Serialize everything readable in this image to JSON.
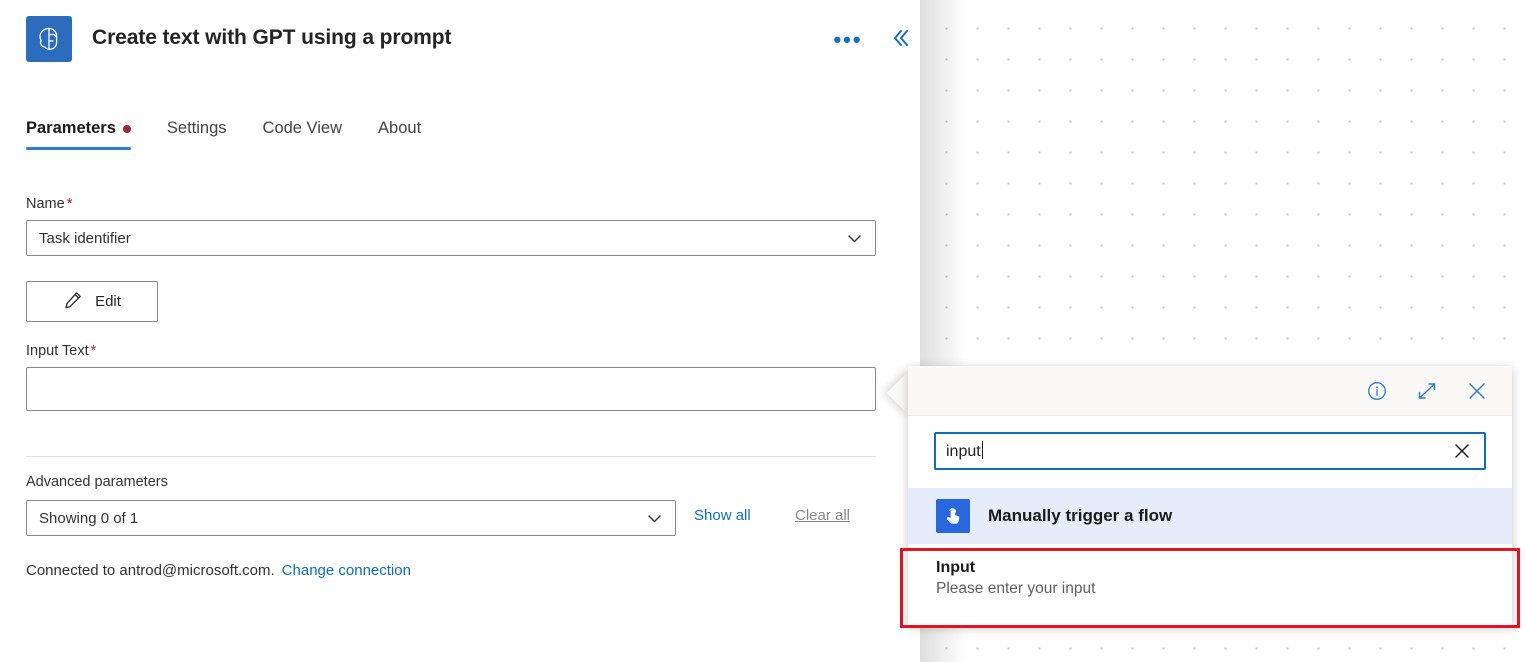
{
  "header": {
    "title": "Create text with GPT using a prompt",
    "app_icon": "gpt-brain-icon",
    "more_label": "•••",
    "more_name": "more-options-icon",
    "collapse_name": "collapse-panel-icon"
  },
  "tabs": [
    {
      "label": "Parameters",
      "active": true,
      "has_dot": true
    },
    {
      "label": "Settings",
      "active": false,
      "has_dot": false
    },
    {
      "label": "Code View",
      "active": false,
      "has_dot": false
    },
    {
      "label": "About",
      "active": false,
      "has_dot": false
    }
  ],
  "form": {
    "name": {
      "label": "Name",
      "required": "*",
      "value": "Task identifier"
    },
    "edit_button": {
      "label": "Edit",
      "icon": "pencil-icon"
    },
    "input_text": {
      "label": "Input Text",
      "required": "*",
      "value": "",
      "placeholder": ""
    },
    "advanced": {
      "label": "Advanced parameters",
      "value": "Showing 0 of 1",
      "show_all": "Show all",
      "clear_all": "Clear all"
    },
    "connection": {
      "text": "Connected to antrod@microsoft.com.",
      "change_link": "Change connection"
    }
  },
  "flyout": {
    "icons": {
      "info": "info-icon",
      "expand": "expand-icon",
      "close": "close-icon"
    },
    "search": {
      "value": "input",
      "placeholder": "Search dynamic content",
      "clear_name": "clear-search-icon"
    },
    "group": {
      "label": "Manually trigger a flow",
      "icon": "manual-trigger-icon"
    },
    "result": {
      "title": "Input",
      "subtitle": "Please enter your input"
    }
  },
  "colors": {
    "accent_blue": "#0f6cbd",
    "icon_blue": "#2b7cd3",
    "required_red": "#a4262c",
    "highlight_red": "#e81123",
    "group_bg": "#e5ecfa",
    "app_icon_bg": "#2b6cbf"
  }
}
